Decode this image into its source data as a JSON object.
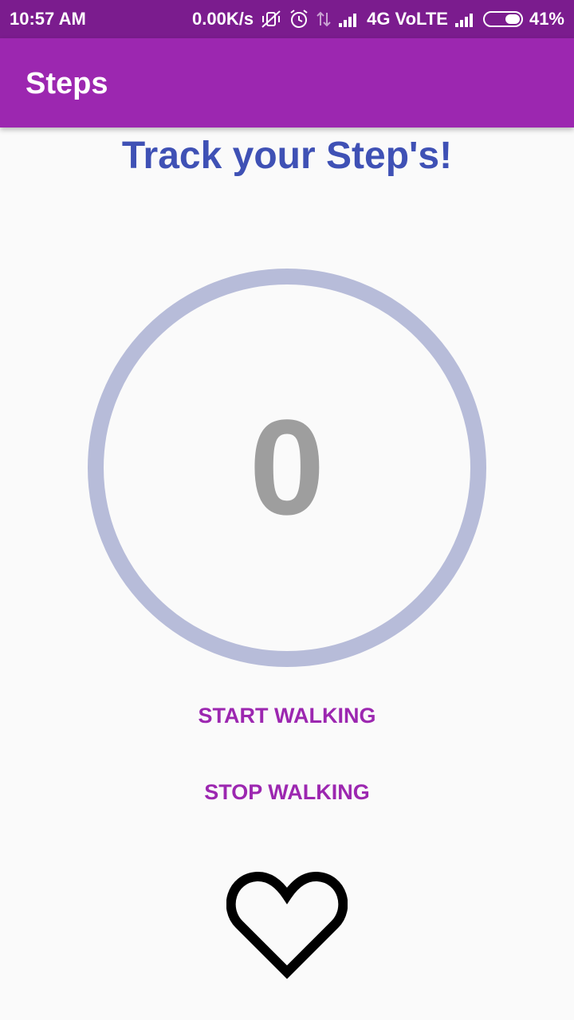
{
  "status_bar": {
    "time": "10:57 AM",
    "speed": "0.00K/s",
    "network": "4G VoLTE",
    "battery": "41%",
    "icons": [
      "vibrate-off-icon",
      "alarm-icon",
      "data-arrows-icon",
      "signal-icon",
      "signal-icon",
      "battery-icon"
    ]
  },
  "app_bar": {
    "title": "Steps"
  },
  "main": {
    "headline": "Track your Step's!",
    "step_count": "0",
    "start_label": "START WALKING",
    "stop_label": "STOP WALKING",
    "heart_icon": "heart-outline-icon"
  },
  "colors": {
    "status_bar": "#7b1c8e",
    "app_bar": "#9c27b0",
    "headline": "#3f51b5",
    "ring": "#b7bcd9",
    "count": "#9e9e9e",
    "button_text": "#9c27b0"
  }
}
